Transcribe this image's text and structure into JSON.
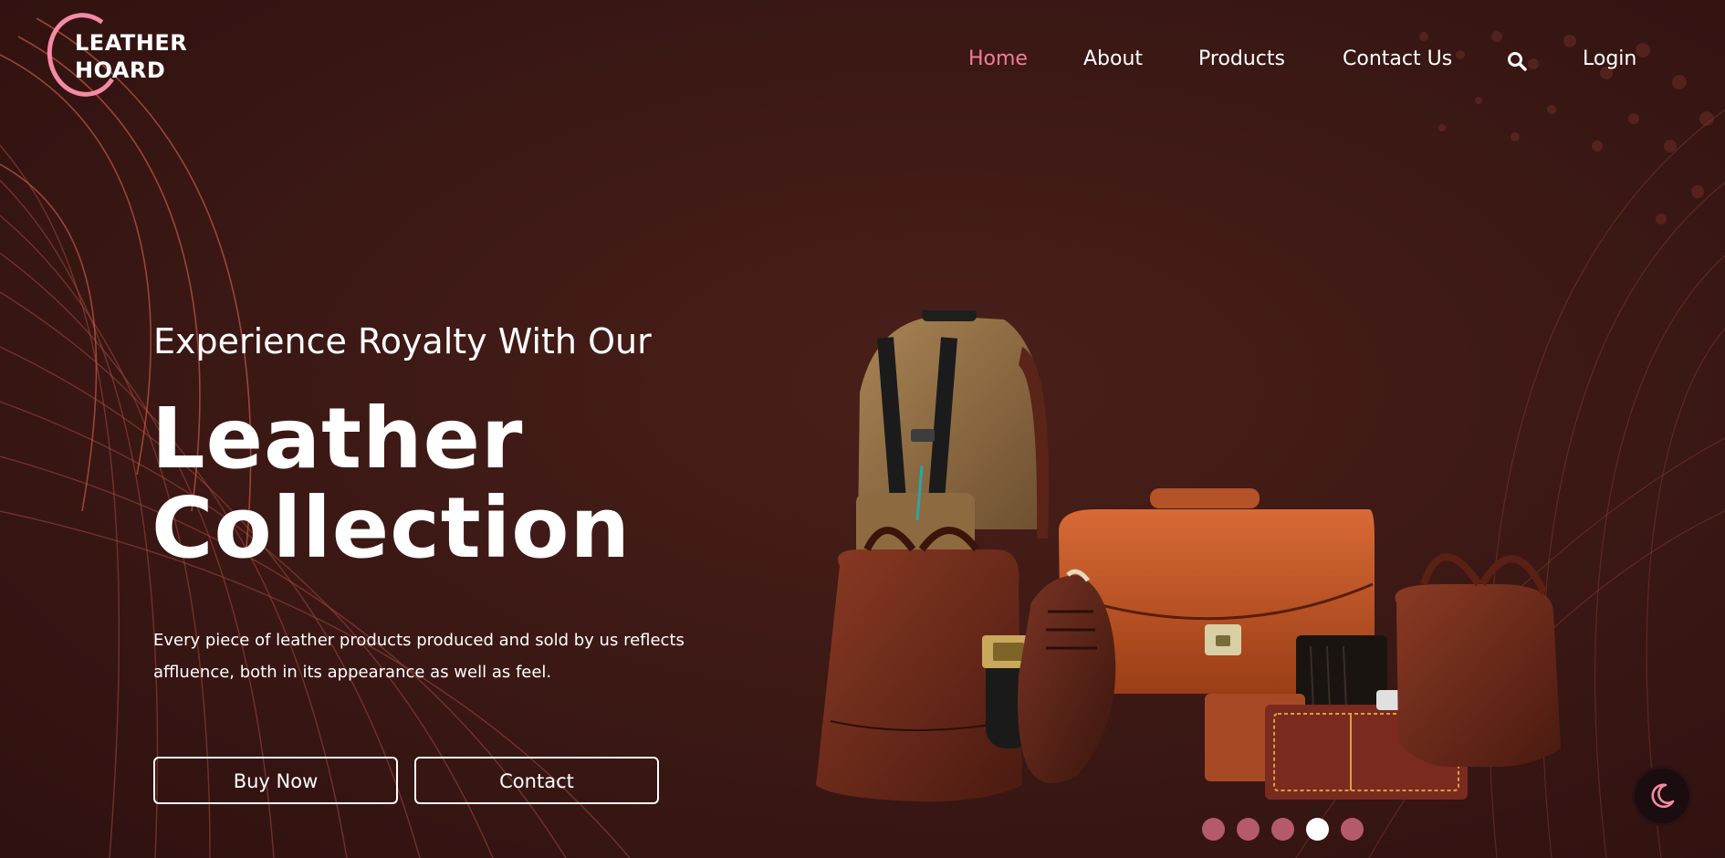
{
  "brand": {
    "line1": "LEATHER",
    "line2": "HOARD",
    "accent_color": "#f58aa5"
  },
  "nav": {
    "items": [
      {
        "label": "Home",
        "active": true
      },
      {
        "label": "About",
        "active": false
      },
      {
        "label": "Products",
        "active": false
      },
      {
        "label": "Contact Us",
        "active": false
      }
    ],
    "search_icon": "search-icon",
    "login_label": "Login",
    "active_color": "#f07d98"
  },
  "hero": {
    "subtitle": "Experience Royalty With Our",
    "title_line1": "Leather",
    "title_line2": "Collection",
    "description": "Every piece of leather products produced and sold by us reflects affluence, both in its appearance as well as feel.",
    "buy_label": "Buy Now",
    "contact_label": "Contact"
  },
  "slider": {
    "count": 5,
    "active_index": 3,
    "dot_color": "#b55a6a",
    "active_color": "#ffffff"
  },
  "theme_toggle": {
    "icon": "moon-icon"
  },
  "colors": {
    "background": "#3d1915",
    "text": "#ffffff"
  }
}
